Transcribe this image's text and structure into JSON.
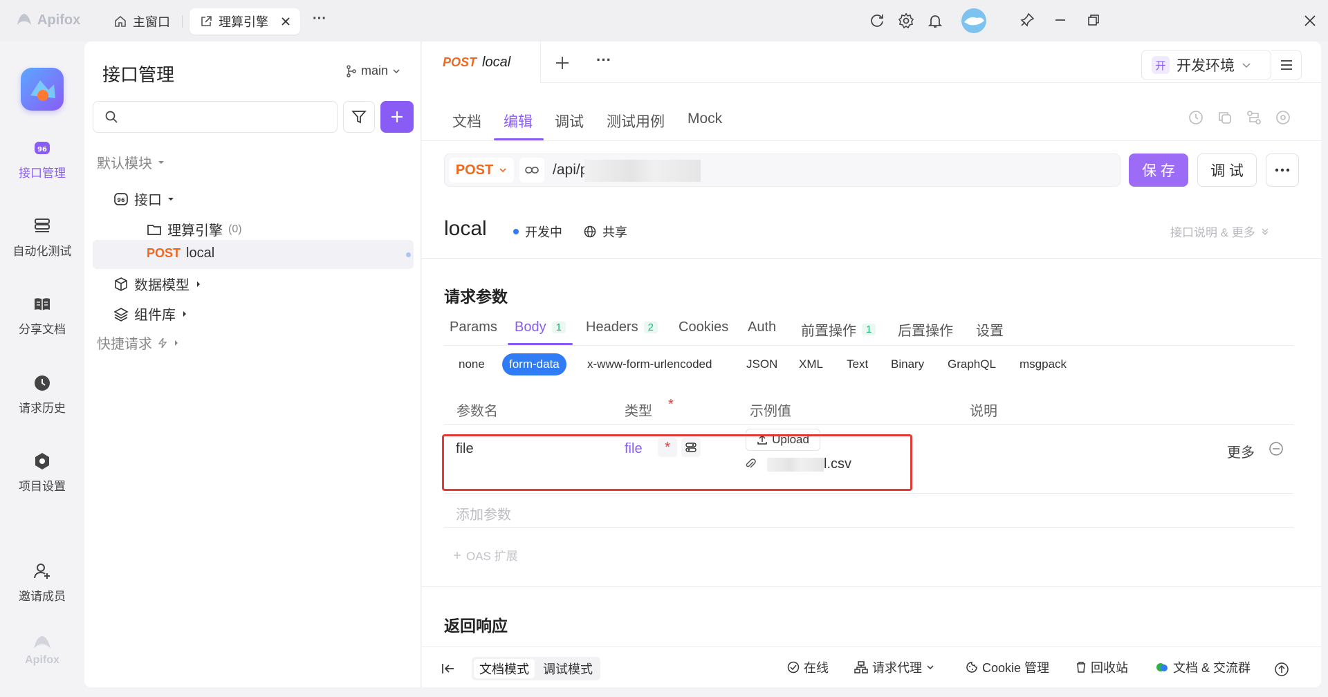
{
  "titlebar": {
    "app_name": "Apifox",
    "tabs": [
      {
        "label": "主窗口"
      },
      {
        "label": "理算引擎"
      }
    ],
    "more": "···"
  },
  "rail": {
    "items": [
      {
        "label": "接口管理",
        "icon": "api-icon",
        "active": true
      },
      {
        "label": "自动化测试",
        "icon": "automation-icon"
      },
      {
        "label": "分享文档",
        "icon": "book-icon"
      },
      {
        "label": "请求历史",
        "icon": "clock-icon"
      },
      {
        "label": "项目设置",
        "icon": "gear-icon"
      },
      {
        "label": "邀请成员",
        "icon": "add-user-icon"
      }
    ],
    "brand": "Apifox"
  },
  "sidebar": {
    "title": "接口管理",
    "branch": "main",
    "search_placeholder": "",
    "tree": {
      "default_module": "默认模块",
      "api_folder": "接口",
      "folder": "理算引擎",
      "folder_count": "(0)",
      "endpoint_method": "POST",
      "endpoint_name": "local",
      "data_model": "数据模型",
      "components": "组件库",
      "quick_request": "快捷请求"
    }
  },
  "main": {
    "request_tab": {
      "method": "POST",
      "name": "local"
    },
    "env": {
      "tag": "开",
      "label": "开发环境"
    },
    "subtabs": [
      "文档",
      "编辑",
      "调试",
      "测试用例",
      "Mock"
    ],
    "active_subtab": "编辑",
    "url": {
      "method": "POST",
      "path": "/api/p"
    },
    "save_label": "保 存",
    "debug_label": "调 试",
    "endpoint": {
      "name": "local",
      "status": "开发中",
      "share": "共享",
      "more_info": "接口说明 & 更多"
    },
    "request_params_title": "请求参数",
    "param_tabs": [
      {
        "label": "Params",
        "count": ""
      },
      {
        "label": "Body",
        "count": "1"
      },
      {
        "label": "Headers",
        "count": "2"
      },
      {
        "label": "Cookies",
        "count": ""
      },
      {
        "label": "Auth",
        "count": ""
      },
      {
        "label": "前置操作",
        "count": "1"
      },
      {
        "label": "后置操作",
        "count": ""
      },
      {
        "label": "设置",
        "count": ""
      }
    ],
    "body_types": [
      "none",
      "form-data",
      "x-www-form-urlencoded",
      "JSON",
      "XML",
      "Text",
      "Binary",
      "GraphQL",
      "msgpack"
    ],
    "active_body_type": "form-data",
    "columns": [
      "参数名",
      "类型",
      "示例值",
      "说明"
    ],
    "row": {
      "name": "file",
      "type": "file",
      "upload_label": "Upload",
      "file_suffix": "l.csv",
      "more": "更多"
    },
    "add_param": "添加参数",
    "oas_ext": "OAS 扩展",
    "response_title": "返回响应"
  },
  "footer": {
    "doc_mode": "文档模式",
    "debug_mode": "调试模式",
    "online": "在线",
    "proxy": "请求代理",
    "cookie": "Cookie 管理",
    "trash": "回收站",
    "community": "文档 & 交流群"
  },
  "colors": {
    "accent": "#8a5cf6",
    "post": "#f0681e",
    "highlight_box": "#e53935"
  }
}
